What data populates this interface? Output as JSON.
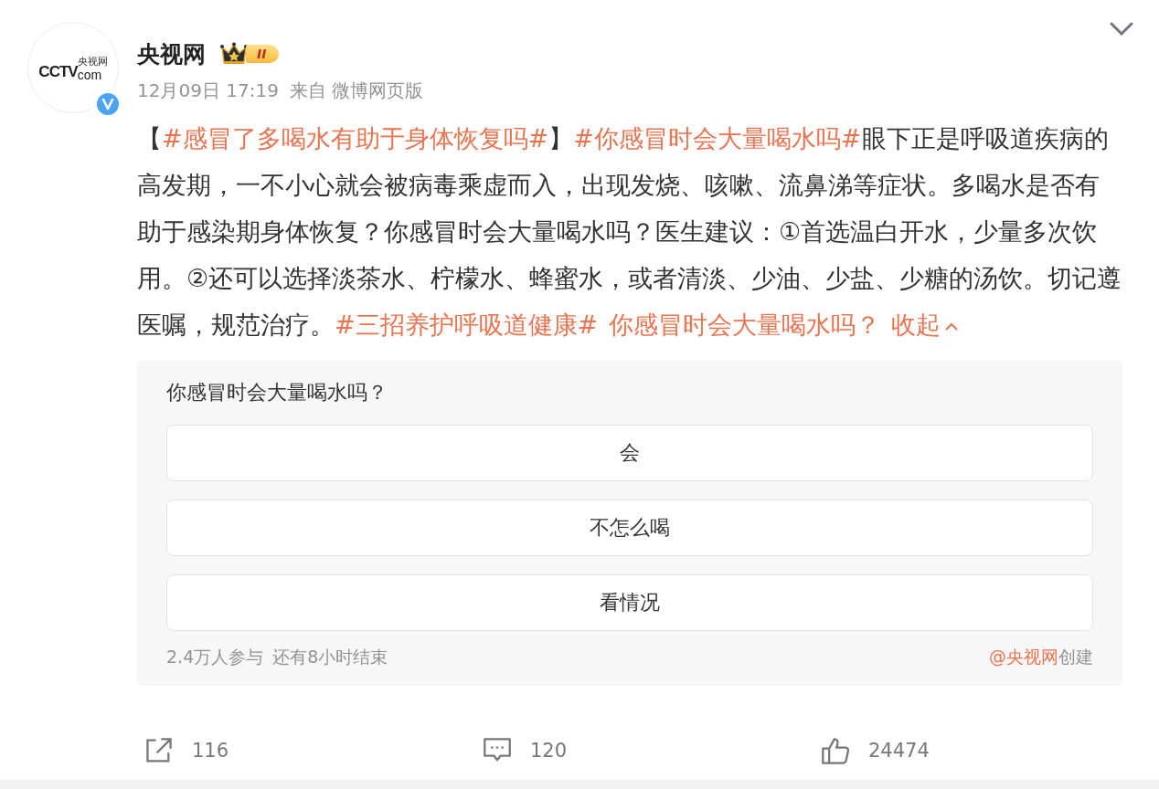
{
  "post": {
    "author": "央视网",
    "avatar": {
      "logo_main": "CCTV",
      "logo_sub": "央视网",
      "logo_com": "com",
      "verified": true
    },
    "badge": {
      "level": "II"
    },
    "time": "12月09日 17:19",
    "source": "来自 微博网页版",
    "body": [
      {
        "kind": "text",
        "text": "【"
      },
      {
        "kind": "topic",
        "text": "#感冒了多喝水有助于身体恢复吗#"
      },
      {
        "kind": "text",
        "text": "】"
      },
      {
        "kind": "topic",
        "text": "#你感冒时会大量喝水吗#"
      },
      {
        "kind": "text",
        "text": "眼下正是呼吸道疾病的高发期，一不小心就会被病毒乘虚而入，出现发烧、咳嗽、流鼻涕等症状。多喝水是否有助于感染期身体恢复？你感冒时会大量喝水吗？医生建议：①首选温白开水，少量多次饮用。②还可以选择淡茶水、柠檬水、蜂蜜水，或者清淡、少油、少盐、少糖的汤饮。切记遵医嘱，规范治疗。"
      },
      {
        "kind": "spacedtopic",
        "text": "#三招养护呼吸道健康#"
      },
      {
        "kind": "spacedtopic",
        "text": "你感冒时会大量喝水吗？"
      },
      {
        "kind": "collapse",
        "text": "收起"
      }
    ],
    "poll": {
      "question": "你感冒时会大量喝水吗？",
      "options": [
        "会",
        "不怎么喝",
        "看情况"
      ],
      "participants": "2.4万人参与",
      "remaining": "还有8小时结束",
      "creator": "@央视网",
      "created": "创建"
    },
    "actions": [
      {
        "kind": "repost",
        "count": "116"
      },
      {
        "kind": "comment",
        "count": "120"
      },
      {
        "kind": "like",
        "count": "24474"
      }
    ]
  }
}
